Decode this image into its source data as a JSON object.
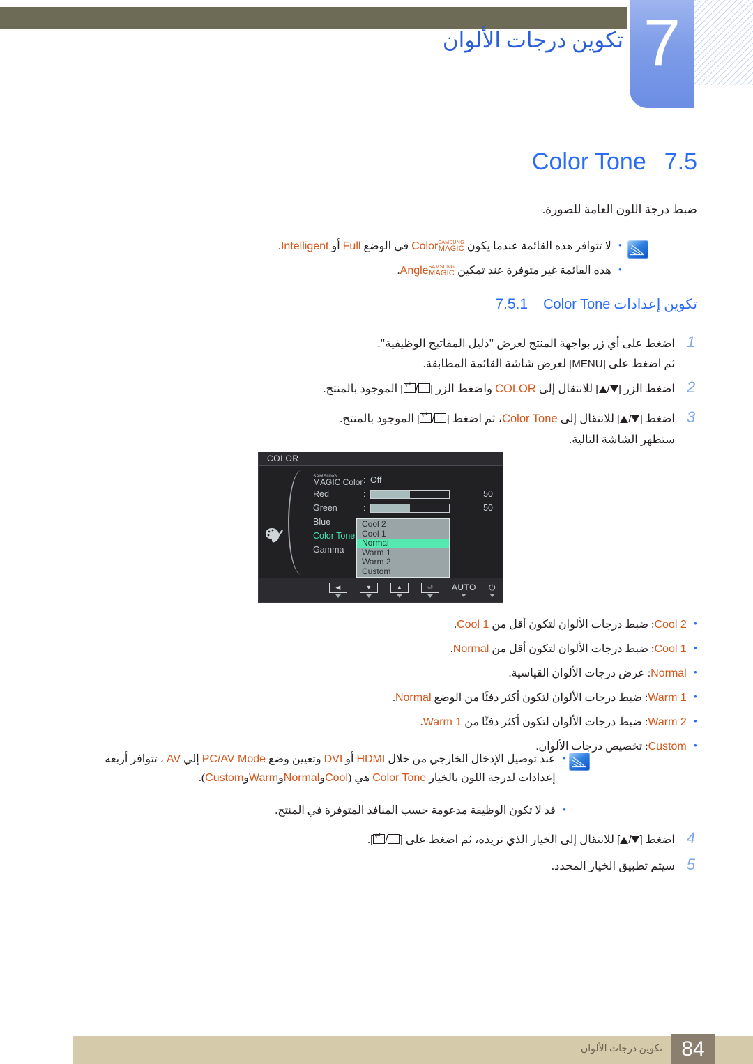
{
  "header": {
    "chapter_number": "7",
    "chapter_title": "تكوين درجات الألوان"
  },
  "section": {
    "number": "7.5",
    "name": "Color Tone",
    "intro": "ضبط درجة اللون العامة للصورة."
  },
  "intro_notes": {
    "icon": "note-icon",
    "items": [
      {
        "pre": ".",
        "segments": [
          {
            "t": "لا تتوافر هذه القائمة عندما يكون ",
            "k": "ar"
          },
          {
            "t": "Color",
            "k": "magic"
          },
          {
            "t": " في الوضع ",
            "k": "ar"
          },
          {
            "t": "Full",
            "k": "or"
          },
          {
            "t": " أو ",
            "k": "ar"
          },
          {
            "t": "Intelligent",
            "k": "or"
          },
          {
            "t": ".",
            "k": "ar"
          }
        ],
        "plain": "لا تتوافر هذه القائمة عندما يكون SAMSUNG MAGIC Color في الوضع Full أو Intelligent."
      },
      {
        "plain": "هذه القائمة غير متوفرة عند تمكين SAMSUNG MAGIC Angle."
      }
    ]
  },
  "subsection": {
    "number": "7.5.1",
    "text": "تكوين إعدادات",
    "name": "Color Tone"
  },
  "steps": [
    {
      "n": "1",
      "line1": "اضغط على أي زر بواجهة المنتج لعرض \"دليل المفاتيح الوظيفية\".",
      "line2_pre": "ثم اضغط على ",
      "line2_key": "MENU",
      "line2_post": " لعرض شاشة القائمة المطابقة."
    },
    {
      "n": "2",
      "a": "اضغط الزر ",
      "key1": "▲/▼",
      "b": " للانتقال إلى ",
      "target": "COLOR",
      "c": " واضغط الزر ",
      "key2": "[ ⎆ / ▭ ]",
      "d": " الموجود بالمنتج."
    },
    {
      "n": "3",
      "a": "اضغط ",
      "key1": "▲/▼",
      "b": " للانتقال إلى ",
      "target": "Color Tone",
      "c": "، ثم اضغط ",
      "key2": "[ ⎆ / ▭ ]",
      "d": " الموجود بالمنتج.",
      "line2": "ستظهر الشاشة التالية."
    },
    {
      "n": "4",
      "a": "اضغط ",
      "key1": "▲/▼",
      "b": " للانتقال إلى الخيار الذي تريده، ثم اضغط على ",
      "key2": "[ ⎆ / ▭ ]",
      "d": "."
    },
    {
      "n": "5",
      "a": "سيتم تطبيق الخيار المحدد."
    }
  ],
  "osd": {
    "title": "COLOR",
    "icon": "palette-icon",
    "rows": [
      {
        "label_small": "SAMSUNG",
        "label_big": "MAGIC",
        "label_rest": " Color",
        "colon": ":",
        "value": "Off",
        "type": "value"
      },
      {
        "label": "Red",
        "colon": ":",
        "type": "bar",
        "fill_percent": 50,
        "number": "50"
      },
      {
        "label": "Green",
        "colon": ":",
        "type": "bar",
        "fill_percent": 50,
        "number": "50"
      },
      {
        "label": "Blue",
        "colon": ":",
        "type": "blank"
      },
      {
        "label": "Color Tone",
        "colon": ":",
        "type": "blank",
        "selected": true
      },
      {
        "label": "Gamma",
        "colon": ":",
        "type": "blank"
      }
    ],
    "dropdown": {
      "items": [
        "Cool 2",
        "Cool 1",
        "Normal",
        "Warm 1",
        "Warm 2",
        "Custom"
      ],
      "highlighted": "Normal",
      "highlight_color": "#55e8b0"
    },
    "footer_buttons": [
      {
        "name": "left-button",
        "glyph": "◀"
      },
      {
        "name": "down-button",
        "glyph": "▼"
      },
      {
        "name": "up-button",
        "glyph": "▲"
      },
      {
        "name": "enter-button",
        "glyph": "⏎"
      },
      {
        "name": "auto-button",
        "glyph": "AUTO"
      },
      {
        "name": "power-button",
        "glyph": "⏻"
      }
    ]
  },
  "option_list": [
    {
      "name": "Cool 2",
      "desc": "ضبط درجات الألوان لتكون أقل من ",
      "ref": "Cool 1",
      "end": "."
    },
    {
      "name": "Cool 1",
      "desc": "ضبط درجات الألوان لتكون أقل من ",
      "ref": "Normal",
      "end": "."
    },
    {
      "name": "Normal",
      "desc": "عرض درجات الألوان القياسية.",
      "ref": "",
      "end": ""
    },
    {
      "name": "Warm 1",
      "desc": "ضبط درجات الألوان لتكون أكثر دفئًا من الوضع ",
      "ref": "Normal",
      "end": "."
    },
    {
      "name": "Warm 2",
      "desc": "ضبط درجات الألوان لتكون أكثر دفئًا من ",
      "ref": "Warm 1",
      "end": "."
    },
    {
      "name": "Custom",
      "desc": "تخصيص درجات الألوان.",
      "ref": "",
      "end": ""
    }
  ],
  "bottom_notes": {
    "icon": "note-icon",
    "line1_a": "عند توصيل الإدخال الخارجي من خلال ",
    "line1_hdmi": "HDMI",
    "line1_b": " أو ",
    "line1_dvi": "DVI",
    "line1_c": " وتعيين وضع ",
    "line1_mode": "PC/AV Mode",
    "line1_d": " إلي ",
    "line1_av": "AV",
    "line1_e": " ، تتوافر أربعة",
    "line2_a": "إعدادات لدرجة اللون بالخيار ",
    "line2_name": "Color Tone",
    "line2_b": " هي (",
    "line2_opts": [
      "Cool",
      "Normal",
      "Warm",
      "Custom"
    ],
    "line2_sep": "و",
    "line2_end": ").",
    "line3": "قد لا تكون الوظيفة مدعومة حسب المنافذ المتوفرة في المنتج."
  },
  "footer": {
    "page_number": "84",
    "chapter_label": "تكوين درجات الألوان"
  },
  "colors": {
    "header_bar": "#6d6a56",
    "chapter_tab": "#7e9ce8",
    "title_blue": "#2a6cf4",
    "orange": "#d4561a",
    "footer_band": "#d5cbab",
    "footer_num_box": "#8b8070",
    "osd_bg": "#212124",
    "osd_highlight": "#55e8b0",
    "osd_selected_label": "#3fe0a6"
  }
}
